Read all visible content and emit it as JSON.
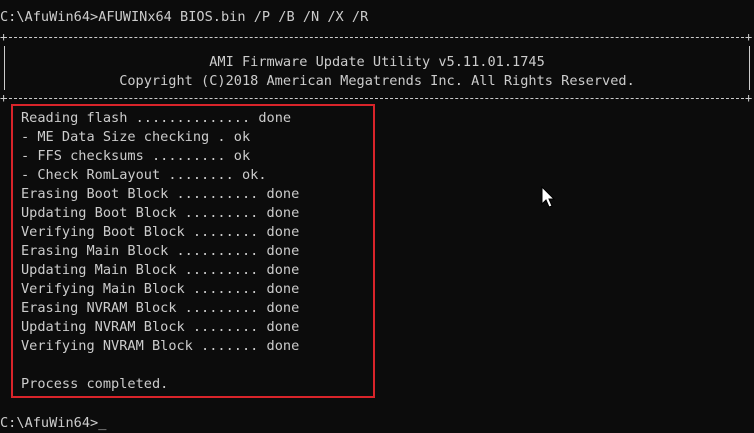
{
  "terminal": {
    "command_line": "C:\\AfuWin64>AFUWINx64 BIOS.bin /P /B /N /X /R",
    "banner": {
      "title": "AMI Firmware Update Utility v5.11.01.1745",
      "copyright": "Copyright (C)2018 American Megatrends Inc. All Rights Reserved."
    },
    "log": [
      "Reading flash .............. done",
      "- ME Data Size checking . ok",
      "- FFS checksums ......... ok",
      "- Check RomLayout ........ ok.",
      "Erasing Boot Block .......... done",
      "Updating Boot Block ......... done",
      "Verifying Boot Block ........ done",
      "Erasing Main Block .......... done",
      "Updating Main Block ......... done",
      "Verifying Main Block ........ done",
      "Erasing NVRAM Block ......... done",
      "Updating NVRAM Block ........ done",
      "Verifying NVRAM Block ....... done",
      "",
      "Process completed."
    ],
    "prompt": "C:\\AfuWin64>_"
  },
  "colors": {
    "background": "#0c0c0c",
    "text": "#cccccc",
    "highlight": "#d9242a"
  },
  "icons": {
    "cursor": "mouse-pointer-icon"
  }
}
